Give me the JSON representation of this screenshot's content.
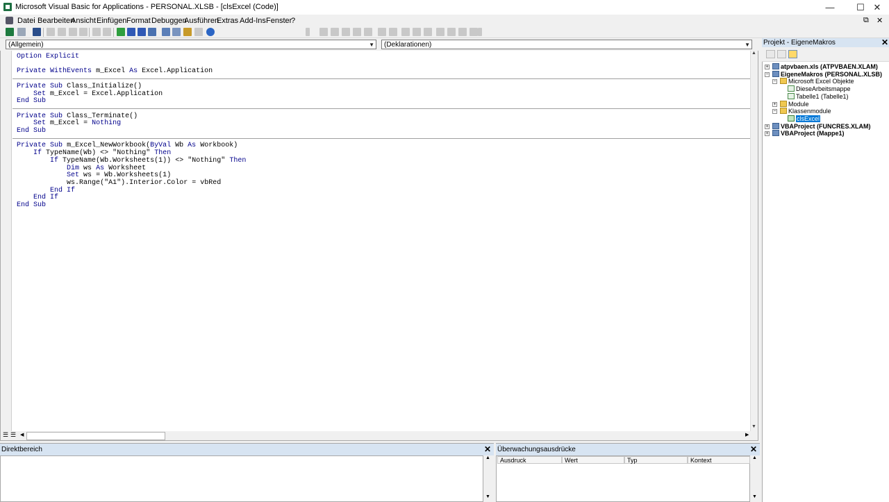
{
  "window": {
    "title": "Microsoft Visual Basic for Applications - PERSONAL.XLSB - [clsExcel (Code)]",
    "minimize": "—",
    "maximize": "☐",
    "close": "✕"
  },
  "menu": {
    "items": [
      "Datei",
      "Bearbeiten",
      "Ansicht",
      "Einfügen",
      "Format",
      "Debuggen",
      "Ausführen",
      "Extras",
      "Add-Ins",
      "Fenster",
      "?"
    ],
    "mdi_restore": "⧉",
    "mdi_close": "✕"
  },
  "code": {
    "object_combo": "(Allgemein)",
    "procedure_combo": "(Deklarationen)",
    "lines": [
      "Option Explicit",
      "",
      "Private WithEvents m_Excel As Excel.Application",
      "",
      "Private Sub Class_Initialize()",
      "    Set m_Excel = Excel.Application",
      "End Sub",
      "",
      "Private Sub Class_Terminate()",
      "    Set m_Excel = Nothing",
      "End Sub",
      "",
      "Private Sub m_Excel_NewWorkbook(ByVal Wb As Workbook)",
      "    If TypeName(Wb) <> \"Nothing\" Then",
      "        If TypeName(Wb.Worksheets(1)) <> \"Nothing\" Then",
      "            Dim ws As Worksheet",
      "            Set ws = Wb.Worksheets(1)",
      "            ws.Range(\"A1\").Interior.Color = vbRed",
      "        End If",
      "    End If",
      "End Sub"
    ],
    "keywords": [
      "Option",
      "Explicit",
      "Private",
      "WithEvents",
      "As",
      "Sub",
      "End",
      "Set",
      "Nothing",
      "ByVal",
      "If",
      "Then",
      "Dim"
    ]
  },
  "project": {
    "title": "Projekt - EigeneMakros",
    "close": "✕",
    "tree": [
      {
        "label": "atpvbaen.xls (ATPVBAEN.XLAM)",
        "level": 0,
        "expander": "+",
        "icon": "project-icon",
        "bold": true
      },
      {
        "label": "EigeneMakros (PERSONAL.XLSB)",
        "level": 0,
        "expander": "−",
        "icon": "project-icon",
        "bold": true
      },
      {
        "label": "Microsoft Excel Objekte",
        "level": 1,
        "expander": "−",
        "icon": "folder-icon",
        "bold": false
      },
      {
        "label": "DieseArbeitsmappe",
        "level": 2,
        "expander": "",
        "icon": "workbook-icon",
        "bold": false
      },
      {
        "label": "Tabelle1 (Tabelle1)",
        "level": 2,
        "expander": "",
        "icon": "sheet-icon",
        "bold": false
      },
      {
        "label": "Module",
        "level": 1,
        "expander": "+",
        "icon": "folder-icon",
        "bold": false
      },
      {
        "label": "Klassenmodule",
        "level": 1,
        "expander": "−",
        "icon": "folder-icon",
        "bold": false
      },
      {
        "label": "clsExcel",
        "level": 2,
        "expander": "",
        "icon": "class-module-icon",
        "bold": false,
        "selected": true
      },
      {
        "label": "VBAProject (FUNCRES.XLAM)",
        "level": 0,
        "expander": "+",
        "icon": "project-icon",
        "bold": true
      },
      {
        "label": "VBAProject (Mappe1)",
        "level": 0,
        "expander": "+",
        "icon": "project-icon",
        "bold": true
      }
    ]
  },
  "immediate": {
    "title": "Direktbereich",
    "close": "✕"
  },
  "watch": {
    "title": "Überwachungsausdrücke",
    "close": "✕",
    "columns": [
      "Ausdruck",
      "Wert",
      "Typ",
      "Kontext"
    ]
  },
  "colors": {
    "keyword": "#00008b",
    "pane_header": "#d7e4f2",
    "selection": "#0078d7"
  }
}
